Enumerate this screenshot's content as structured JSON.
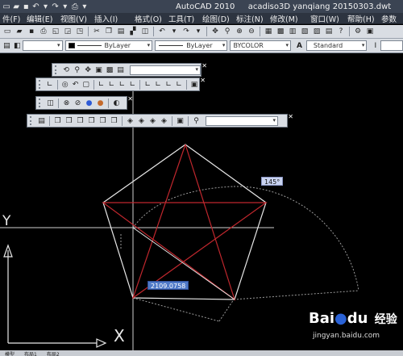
{
  "titlebar": {
    "app": "AutoCAD 2010",
    "file": "acadiso3D  yanqiang 20150303.dwt"
  },
  "menu": [
    "件(F)",
    "编辑(E)",
    "视图(V)",
    "插入(I)",
    "格式(O)",
    "工具(T)",
    "绘图(D)",
    "标注(N)",
    "修改(M)",
    "窗口(W)",
    "帮助(H)",
    "参数"
  ],
  "properties": {
    "color": "ByLayer",
    "linetype": "ByLayer",
    "lineweight": "BYCOLOR",
    "textstyle": "Standard"
  },
  "drawing": {
    "angle_label": "145°",
    "length_input": "2109.0758",
    "ucs_y": "Y",
    "ucs_x": "X"
  },
  "watermark": {
    "brand": "Bai",
    "brand2": "du",
    "sub": "经验",
    "url": "jingyan.baidu.com"
  },
  "tabs": [
    "模型",
    "布局1",
    "布局2"
  ]
}
